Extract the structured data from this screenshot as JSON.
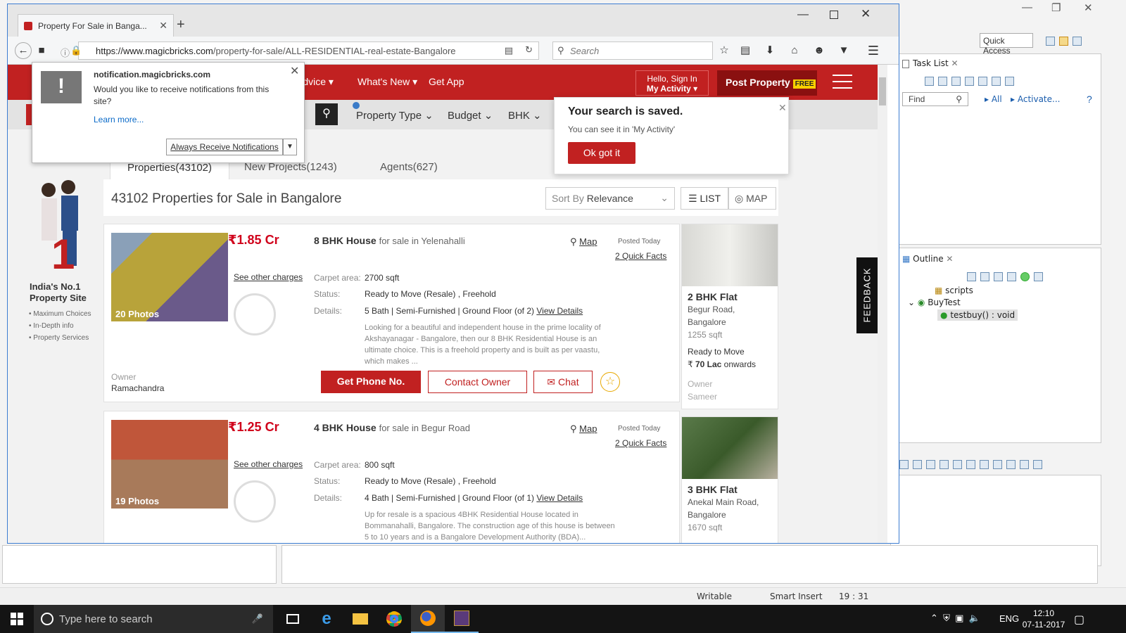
{
  "eclipse": {
    "quick_access": "Quick Access",
    "task_list": {
      "title": "Task List",
      "find_placeholder": "Find",
      "all": "All",
      "activate": "Activate..."
    },
    "outline": {
      "title": "Outline",
      "items": [
        "scripts",
        "BuyTest",
        "testbuy() : void"
      ]
    },
    "status": {
      "writable": "Writable",
      "insert": "Smart Insert",
      "position": "19 : 31"
    }
  },
  "taskbar": {
    "search_placeholder": "Type here to search",
    "lang": "ENG",
    "time": "12:10",
    "date": "07-11-2017"
  },
  "browser": {
    "tab_title": "Property For Sale in Banga...",
    "url_host": "https://www.magicbricks.com",
    "url_path": "/property-for-sale/ALL-RESIDENTIAL-real-estate-Bangalore",
    "search_placeholder": "Search"
  },
  "header": {
    "links": [
      "Advice",
      "What's New",
      "Get App"
    ],
    "signin_line1": "Hello, Sign In",
    "signin_line2": "My Activity",
    "post_property": "Post Property",
    "free_badge": "FREE"
  },
  "filters": [
    "Property Type",
    "Budget",
    "BHK"
  ],
  "tabs": [
    "Properties(43102)",
    "New Projects(1243)",
    "Agents(627)"
  ],
  "results": {
    "heading": "43102 Properties for Sale in Bangalore",
    "sort_prefix": "Sort By",
    "sort_value": "Relevance",
    "list_label": "LIST",
    "map_label": "MAP"
  },
  "promo": {
    "title_line1": "India's No.1",
    "title_line2": "Property Site",
    "points": [
      "Maximum Choices",
      "In-Depth info",
      "Property Services"
    ]
  },
  "listings": [
    {
      "price": "1.85 Cr",
      "title_bold": "8 BHK House",
      "title_rest": "for sale in Yelenahalli",
      "map": "Map",
      "posted": "Posted Today",
      "quick_facts": "2 Quick Facts",
      "other_charges": "See other charges",
      "photos": "20 Photos",
      "carpet_label": "Carpet area:",
      "carpet_value": "2700 sqft",
      "status_label": "Status:",
      "status_value": "Ready to Move (Resale) , Freehold",
      "details_label": "Details:",
      "details_value": "5 Bath | Semi-Furnished | Ground Floor (of 2)",
      "view_details": "View Details",
      "description": "Looking for a beautiful and independent house in the prime locality of Akshayanagar - Bangalore, then our 8 BHK Residential House is an ultimate choice. This is a freehold property and is built as per vaastu, which makes ...",
      "owner_label": "Owner",
      "owner_name": "Ramachandra",
      "phone_btn": "Get Phone No.",
      "contact_btn": "Contact Owner",
      "chat_btn": "Chat"
    },
    {
      "price": "1.25 Cr",
      "title_bold": "4 BHK House",
      "title_rest": "for sale in Begur Road",
      "map": "Map",
      "posted": "Posted Today",
      "quick_facts": "2 Quick Facts",
      "other_charges": "See other charges",
      "photos": "19 Photos",
      "carpet_label": "Carpet area:",
      "carpet_value": "800 sqft",
      "status_label": "Status:",
      "status_value": "Ready to Move (Resale) , Freehold",
      "details_label": "Details:",
      "details_value": "4 Bath | Semi-Furnished | Ground Floor (of 1)",
      "view_details": "View Details",
      "description": "Up for resale is a spacious 4BHK Residential House located in Bommanahalli, Bangalore. The construction age of this house is between 5 to 10 years and is a Bangalore Development Authority (BDA)..."
    }
  ],
  "side_cards": [
    {
      "title": "2 BHK Flat",
      "loc1": "Begur Road,",
      "loc2": "Bangalore",
      "area": "1255 sqft",
      "status": "Ready to Move",
      "price": "70 Lac",
      "price_suffix": "onwards",
      "owner_label": "Owner",
      "owner": "Sameer"
    },
    {
      "title": "3 BHK Flat",
      "loc1": "Anekal Main Road,",
      "loc2": "Bangalore",
      "area": "1670 sqft"
    }
  ],
  "notification": {
    "host": "notification.magicbricks.com",
    "message": "Would you like to receive notifications from this site?",
    "learn_more": "Learn more...",
    "button": "Always Receive Notifications"
  },
  "saved_popup": {
    "title": "Your search is saved.",
    "message": "You can see it in 'My Activity'",
    "button": "Ok got it"
  },
  "feedback": "FEEDBACK"
}
